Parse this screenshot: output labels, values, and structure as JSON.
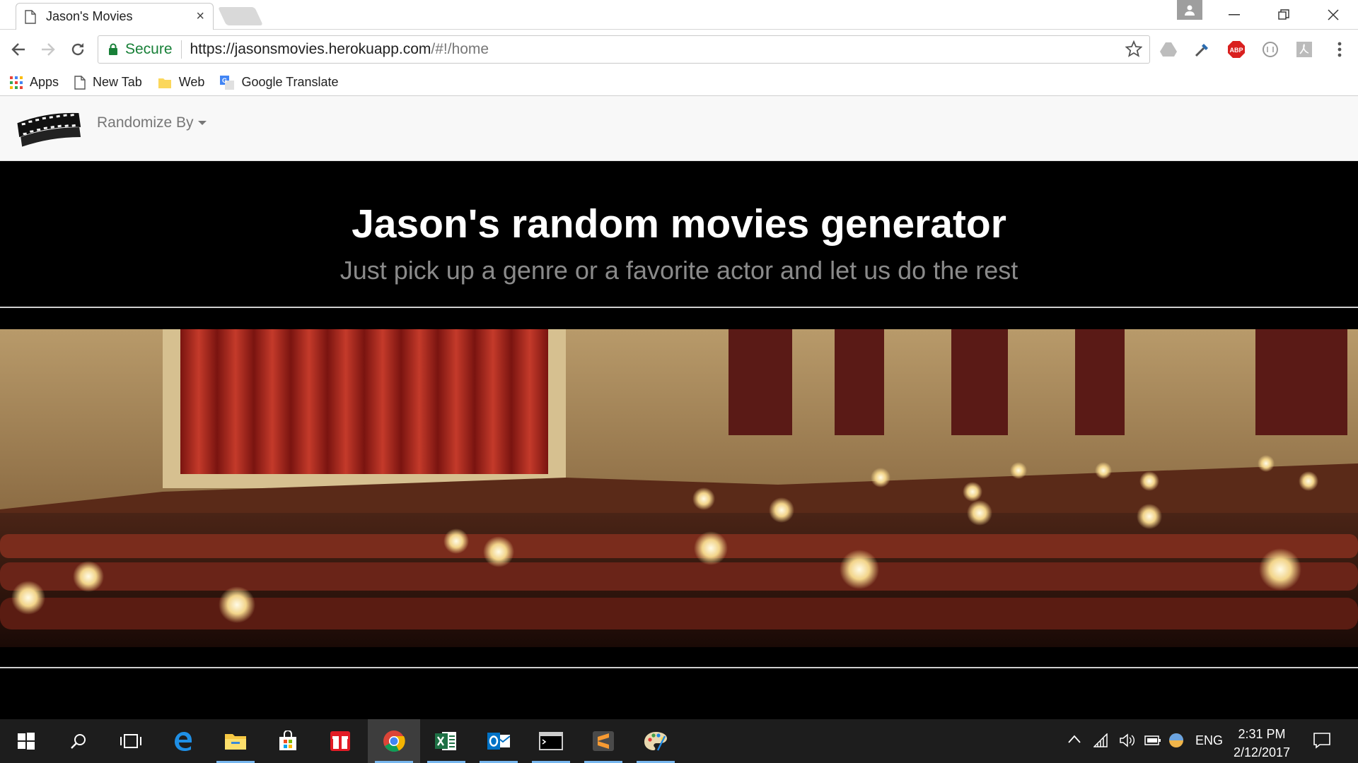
{
  "browser": {
    "tab_title": "Jason's Movies",
    "tab_close": "×",
    "secure_label": "Secure",
    "url_main": "https://jasonsmovies.herokuapp.com",
    "url_rest": "/#!/home"
  },
  "bookmarks": [
    {
      "label": "Apps",
      "icon": "apps-grid-icon"
    },
    {
      "label": "New Tab",
      "icon": "page-icon"
    },
    {
      "label": "Web",
      "icon": "folder-icon"
    },
    {
      "label": "Google Translate",
      "icon": "translate-icon"
    }
  ],
  "navbar": {
    "dropdown_label": "Randomize By"
  },
  "hero": {
    "title": "Jason's random movies generator",
    "subtitle": "Just pick up a genre or a favorite actor and let us do the rest"
  },
  "taskbar": {
    "language": "ENG",
    "time": "2:31 PM",
    "date": "2/12/2017"
  },
  "colors": {
    "secure_green": "#188038",
    "hero_bg": "#000000",
    "navbar_bg": "#f8f8f8",
    "taskbar_bg": "#1d1d1d"
  }
}
